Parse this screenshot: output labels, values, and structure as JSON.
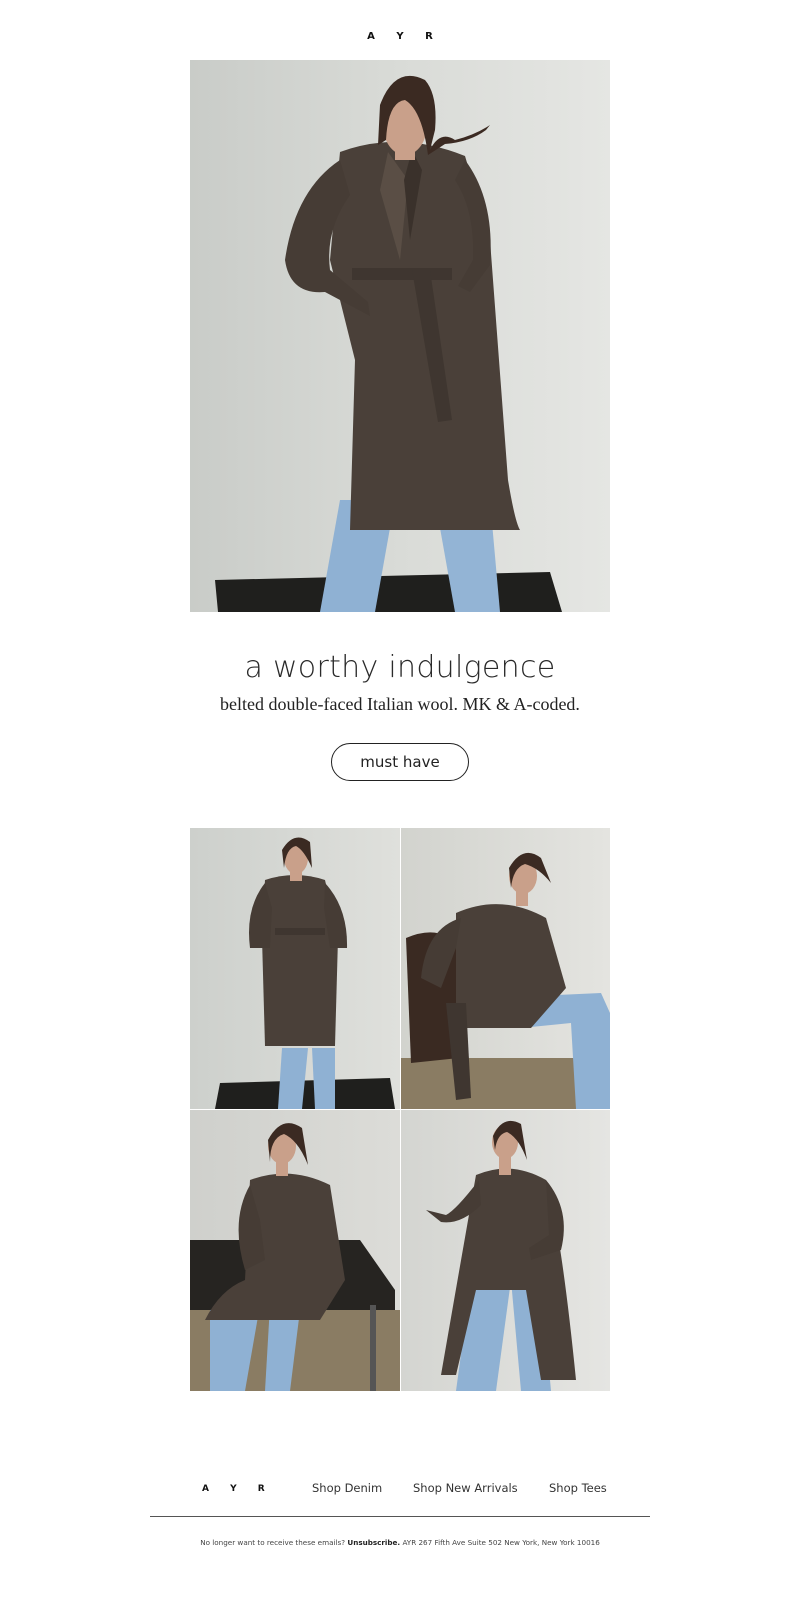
{
  "brand": {
    "logo_text": "A Y R"
  },
  "hero": {
    "headline": "a worthy indulgence",
    "subhead": "belted double-faced Italian wool. MK & A-coded.",
    "cta_label": "must have"
  },
  "footer": {
    "logo_text": "A Y R",
    "links": [
      {
        "label": "Shop Denim"
      },
      {
        "label": "Shop New Arrivals"
      },
      {
        "label": "Shop Tees"
      }
    ],
    "legal": {
      "prefix": "No longer want to receive these emails?",
      "unsubscribe_label": "Unsubscribe.",
      "address": "AYR 267 Fifth Ave Suite 502 New York, New York 10016"
    }
  },
  "colors": {
    "coat": "#4a4039",
    "denim": "#8fb1d3",
    "hair": "#3b2a22",
    "skin": "#c9a08a",
    "backdrop": "#dcdedb",
    "text": "#222222"
  }
}
